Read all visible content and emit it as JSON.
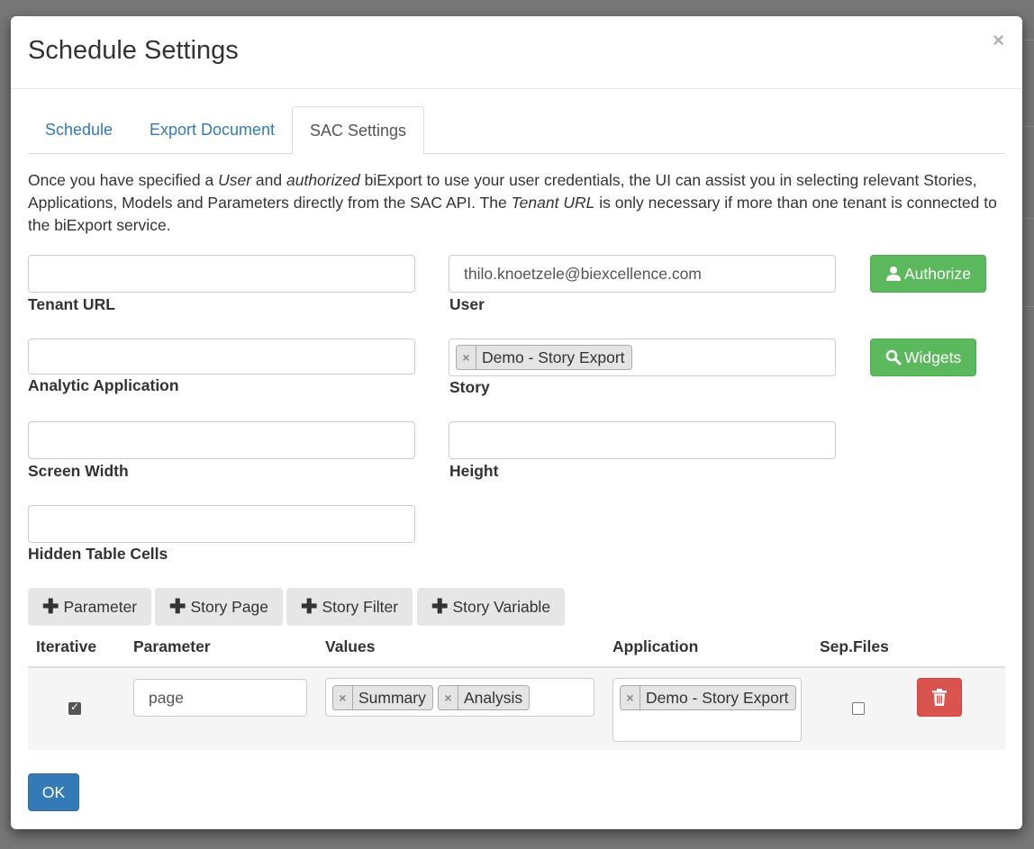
{
  "modal": {
    "title": "Schedule Settings",
    "close_symbol": "×"
  },
  "tabs": [
    {
      "label": "Schedule",
      "active": false
    },
    {
      "label": "Export Document",
      "active": false
    },
    {
      "label": "SAC Settings",
      "active": true
    }
  ],
  "intro": {
    "part1": "Once you have specified a ",
    "user_em": "User",
    "part2": " and ",
    "authorized_em": "authorized",
    "part3": " biExport to use your user credentials, the UI can assist you in selecting relevant Stories, Applications, Models and Parameters directly from the SAC API. The ",
    "tenant_em": "Tenant URL",
    "part4": " is only necessary if more than one tenant is connected to the biExport service."
  },
  "form": {
    "tenant_url": {
      "label": "Tenant URL",
      "value": ""
    },
    "user": {
      "label": "User",
      "value": "thilo.knoetzele@biexcellence.com"
    },
    "authorize_button": "Authorize",
    "analytic_application": {
      "label": "Analytic Application",
      "value": ""
    },
    "story": {
      "label": "Story",
      "tags": [
        "Demo - Story Export"
      ]
    },
    "widgets_button": "Widgets",
    "screen_width": {
      "label": "Screen Width",
      "value": ""
    },
    "height": {
      "label": "Height",
      "value": ""
    },
    "hidden_table_cells": {
      "label": "Hidden Table Cells",
      "value": ""
    }
  },
  "add_buttons": [
    "Parameter",
    "Story Page",
    "Story Filter",
    "Story Variable"
  ],
  "table": {
    "headers": [
      "Iterative",
      "Parameter",
      "Values",
      "Application",
      "Sep.Files"
    ],
    "rows": [
      {
        "iterative": true,
        "parameter": "page",
        "values": [
          "Summary",
          "Analysis"
        ],
        "application": [
          "Demo - Story Export"
        ],
        "sep_files": false
      }
    ]
  },
  "ok_button": "OK",
  "colors": {
    "success": "#5cb85c",
    "danger": "#d9534f",
    "primary": "#337ab7",
    "link": "#337ab7"
  },
  "icons": {
    "authorize": "user-icon",
    "widgets": "search-icon",
    "add": "plus-icon",
    "delete": "trash-icon",
    "remove_tag": "x-icon"
  }
}
